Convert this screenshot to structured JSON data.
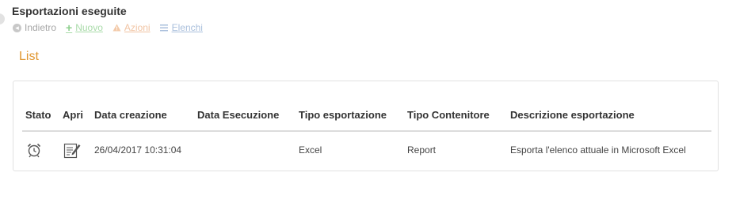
{
  "page": {
    "title": "Esportazioni eseguite"
  },
  "toolbar": {
    "back_label": "Indietro",
    "new_label": "Nuovo",
    "actions_label": "Azioni",
    "lists_label": "Elenchi"
  },
  "section": {
    "title": "List"
  },
  "table": {
    "columns": [
      "Stato",
      "Apri",
      "Data creazione",
      "Data Esecuzione",
      "Tipo esportazione",
      "Tipo Contenitore",
      "Descrizione esportazione"
    ],
    "rows": [
      {
        "stato_icon": "alarm-clock-icon",
        "apri_icon": "edit-document-icon",
        "data_creazione": "26/04/2017 10:31:04",
        "data_esecuzione": "",
        "tipo_esportazione": "Excel",
        "tipo_contenitore": "Report",
        "descrizione": "Esporta l'elenco attuale in Microsoft Excel"
      }
    ]
  },
  "colors": {
    "section_title": "#e0962f",
    "new": "#a9dba9",
    "actions": "#f1c4a3",
    "lists": "#a9bfdc",
    "back": "#a6a6a6"
  }
}
